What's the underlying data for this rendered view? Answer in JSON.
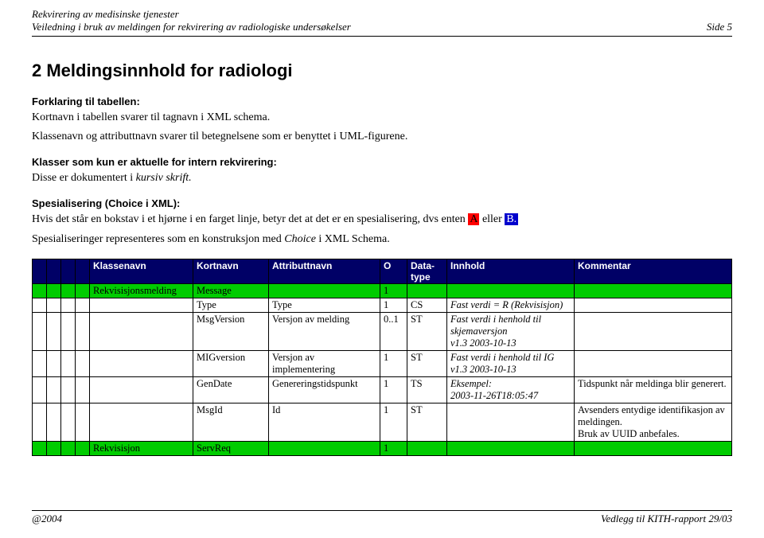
{
  "header": {
    "line1": "Rekvirering av medisinske tjenester",
    "line2": "Veiledning i bruk av meldingen for rekvirering av radiologiske undersøkelser",
    "page_label": "Side 5"
  },
  "section": {
    "title": "2 Meldingsinnhold for radiologi",
    "sub1": "Forklaring til tabellen:",
    "p1": "Kortnavn i tabellen svarer til tagnavn i XML schema.",
    "p2": "Klassenavn og attributtnavn svarer til betegnelsene som er benyttet i UML-figurene.",
    "sub2": "Klasser som kun er aktuelle for intern rekvirering:",
    "p3_pre": "Disse er dokumentert i ",
    "p3_it": "kursiv skrift.",
    "sub3": "Spesialisering (Choice i XML):",
    "p4_pre": "Hvis det står en bokstav i et hjørne i en farget linje, betyr det at det er en spesialisering, dvs enten ",
    "p4_a": "A",
    "p4_mid": " eller ",
    "p4_b": "B.",
    "p5_pre": "Spesialiseringer representeres som en konstruksjon med ",
    "p5_it": "Choice",
    "p5_post": " i XML Schema."
  },
  "table": {
    "head": {
      "klassenavn": "Klassenavn",
      "kortnavn": "Kortnavn",
      "attributtnavn": "Attributtnavn",
      "o": "O",
      "datatype": "Data-type",
      "innhold": "Innhold",
      "kommentar": "Kommentar"
    },
    "rows": {
      "r1_klasse": "Rekvisisjonsmelding",
      "r1_kort": "Message",
      "r1_o": "1",
      "r2_kort": "Type",
      "r2_attr": "Type",
      "r2_o": "1",
      "r2_dt": "CS",
      "r2_it": "Fast verdi = R (Rekvisisjon)",
      "r3_kort": "MsgVersion",
      "r3_attr": "Versjon av melding",
      "r3_o": "0..1",
      "r3_dt": "ST",
      "r3_it_a": "Fast verdi i henhold til skjemaversjon",
      "r3_it_b": "v1.3 2003-10-13",
      "r4_kort": "MIGversion",
      "r4_attr": "Versjon av implementering",
      "r4_o": "1",
      "r4_dt": "ST",
      "r4_it_a": "Fast verdi i henhold til IG",
      "r4_it_b": "v1.3 2003-10-13",
      "r5_kort": "GenDate",
      "r5_attr": "Genereringstidspunkt",
      "r5_o": "1",
      "r5_dt": "TS",
      "r5_it_a": "Eksempel:",
      "r5_it_b": "2003-11-26T18:05:47",
      "r5_kom": "Tidspunkt når meldinga blir generert.",
      "r6_kort": "MsgId",
      "r6_attr": "Id",
      "r6_o": "1",
      "r6_dt": "ST",
      "r6_kom_a": "Avsenders entydige identifikasjon av meldingen.",
      "r6_kom_b": "Bruk av UUID anbefales.",
      "r7_klasse": "Rekvisisjon",
      "r7_kort": "ServReq",
      "r7_o": "1"
    }
  },
  "footer": {
    "left": "@2004",
    "right": "Vedlegg til KITH-rapport 29/03"
  }
}
